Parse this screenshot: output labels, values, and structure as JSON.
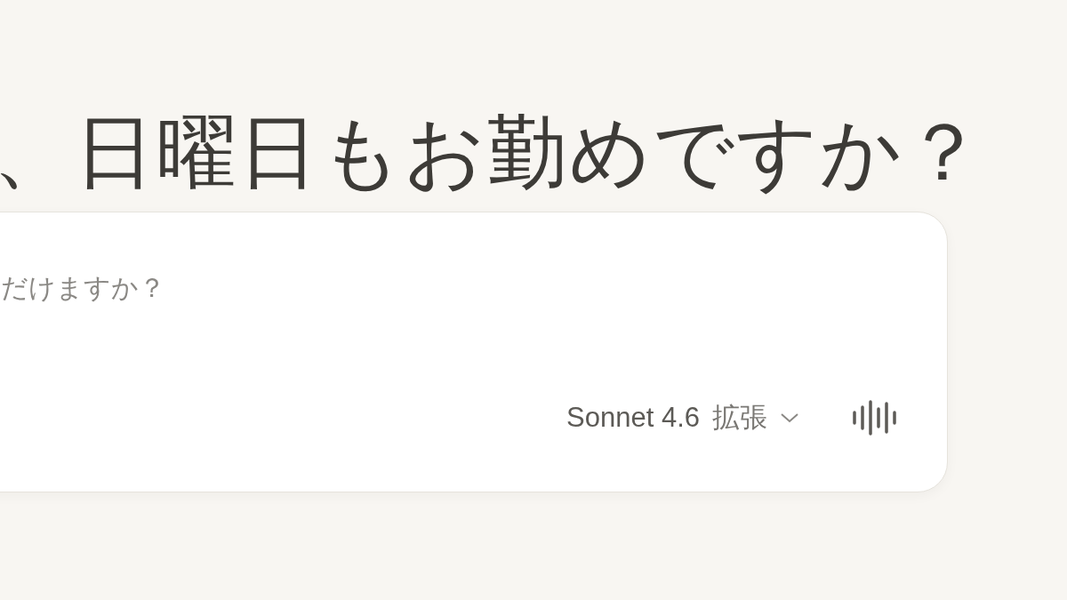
{
  "greeting": "、日曜日もお勤めですか？",
  "composer": {
    "placeholder": "だけますか？",
    "model": "Sonnet 4.6",
    "mode": "拡張"
  }
}
